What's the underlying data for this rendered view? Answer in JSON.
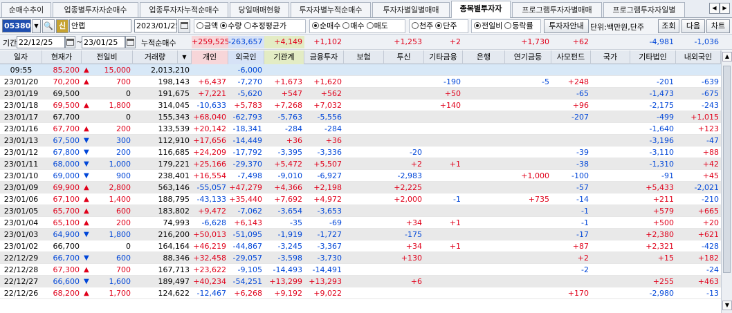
{
  "tabs": [
    "순매수추이",
    "업종별투자자순매수",
    "업종투자자누적순매수",
    "당일매매현황",
    "투자자별누적순매수",
    "투자자별일별매매",
    "종목별투자자",
    "프로그램투자자별매매",
    "프로그램투자자일별"
  ],
  "active_tab": 6,
  "toolbar": {
    "code": "053800",
    "badge": "신",
    "name": "안랩",
    "date": "2023/01/25",
    "r1": [
      "금액",
      "수량",
      "추정평균가"
    ],
    "r1_sel": 1,
    "r2": [
      "순매수",
      "매수",
      "매도"
    ],
    "r2_sel": 0,
    "r3": [
      "천주",
      "단주"
    ],
    "r3_sel": 1,
    "r4": [
      "전일비",
      "등락률"
    ],
    "r4_sel": 0,
    "guide": "투자자안내",
    "unit": "단위:백만원,단주",
    "query": "조회",
    "next": "다음",
    "chart": "차트"
  },
  "filter": {
    "label": "기간",
    "from": "22/12/25",
    "tilde": "~",
    "to": "23/01/25",
    "cum": "누적순매수",
    "sums": [
      "",
      "",
      "",
      "",
      "",
      "+259,525",
      "-263,657",
      "+4,149",
      "+1,102",
      "",
      "+1,253",
      "+2",
      "",
      "+1,730",
      "+62",
      "",
      "-4,981",
      "-1,036"
    ]
  },
  "columns": [
    "일자",
    "현재가",
    "전일비",
    "거래량",
    "개인",
    "외국인",
    "기관계",
    "금융투자",
    "보험",
    "투신",
    "기타금융",
    "은행",
    "연기금등",
    "사모펀드",
    "국가",
    "기타법인",
    "내외국인"
  ],
  "rows": [
    [
      "09:55",
      "85,200",
      "u",
      "15,000",
      "2,013,210",
      "",
      "-6,000",
      "",
      "",
      "",
      "",
      "",
      "",
      "",
      "",
      "",
      ""
    ],
    [
      "23/01/20",
      "70,200",
      "u",
      "700",
      "198,143",
      "+6,437",
      "-7,270",
      "+1,673",
      "+1,620",
      "",
      "",
      "-190",
      "",
      "-5",
      "+248",
      "",
      "-201",
      "-639"
    ],
    [
      "23/01/19",
      "69,500",
      "",
      "0",
      "191,675",
      "+7,221",
      "-5,620",
      "+547",
      "+562",
      "",
      "",
      "+50",
      "",
      "",
      "-65",
      "",
      "-1,473",
      "-675"
    ],
    [
      "23/01/18",
      "69,500",
      "u",
      "1,800",
      "314,045",
      "-10,633",
      "+5,783",
      "+7,268",
      "+7,032",
      "",
      "",
      "+140",
      "",
      "",
      "+96",
      "",
      "-2,175",
      "-243"
    ],
    [
      "23/01/17",
      "67,700",
      "",
      "0",
      "155,343",
      "+68,040",
      "-62,793",
      "-5,763",
      "-5,556",
      "",
      "",
      "",
      "",
      "",
      "-207",
      "",
      "-499",
      "+1,015"
    ],
    [
      "23/01/16",
      "67,700",
      "u",
      "200",
      "133,539",
      "+20,142",
      "-18,341",
      "-284",
      "-284",
      "",
      "",
      "",
      "",
      "",
      "",
      "",
      "-1,640",
      "+123"
    ],
    [
      "23/01/13",
      "67,500",
      "d",
      "300",
      "112,910",
      "+17,656",
      "-14,449",
      "+36",
      "+36",
      "",
      "",
      "",
      "",
      "",
      "",
      "",
      "-3,196",
      "-47"
    ],
    [
      "23/01/12",
      "67,800",
      "d",
      "200",
      "116,685",
      "+24,209",
      "-17,792",
      "-3,395",
      "-3,336",
      "",
      "-20",
      "",
      "",
      "",
      "-39",
      "",
      "-3,110",
      "+88"
    ],
    [
      "23/01/11",
      "68,000",
      "d",
      "1,000",
      "179,221",
      "+25,166",
      "-29,370",
      "+5,472",
      "+5,507",
      "",
      "+2",
      "+1",
      "",
      "",
      "-38",
      "",
      "-1,310",
      "+42"
    ],
    [
      "23/01/10",
      "69,000",
      "d",
      "900",
      "238,401",
      "+16,554",
      "-7,498",
      "-9,010",
      "-6,927",
      "",
      "-2,983",
      "",
      "",
      "+1,000",
      "-100",
      "",
      "-91",
      "+45"
    ],
    [
      "23/01/09",
      "69,900",
      "u",
      "2,800",
      "563,146",
      "-55,057",
      "+47,279",
      "+4,366",
      "+2,198",
      "",
      "+2,225",
      "",
      "",
      "",
      "-57",
      "",
      "+5,433",
      "-2,021"
    ],
    [
      "23/01/06",
      "67,100",
      "u",
      "1,400",
      "188,795",
      "-43,133",
      "+35,440",
      "+7,692",
      "+4,972",
      "",
      "+2,000",
      "-1",
      "",
      "+735",
      "-14",
      "",
      "+211",
      "-210"
    ],
    [
      "23/01/05",
      "65,700",
      "u",
      "600",
      "183,802",
      "+9,472",
      "-7,062",
      "-3,654",
      "-3,653",
      "",
      "",
      "",
      "",
      "",
      "-1",
      "",
      "+579",
      "+665"
    ],
    [
      "23/01/04",
      "65,100",
      "u",
      "200",
      "74,993",
      "-6,628",
      "+6,143",
      "-35",
      "-69",
      "",
      "+34",
      "+1",
      "",
      "",
      "-1",
      "",
      "+500",
      "+20"
    ],
    [
      "23/01/03",
      "64,900",
      "d",
      "1,800",
      "216,200",
      "+50,013",
      "-51,095",
      "-1,919",
      "-1,727",
      "",
      "-175",
      "",
      "",
      "",
      "-17",
      "",
      "+2,380",
      "+621"
    ],
    [
      "23/01/02",
      "66,700",
      "",
      "0",
      "164,164",
      "+46,219",
      "-44,867",
      "-3,245",
      "-3,367",
      "",
      "+34",
      "+1",
      "",
      "",
      "+87",
      "",
      "+2,321",
      "-428"
    ],
    [
      "22/12/29",
      "66,700",
      "d",
      "600",
      "88,346",
      "+32,458",
      "-29,057",
      "-3,598",
      "-3,730",
      "",
      "+130",
      "",
      "",
      "",
      "+2",
      "",
      "+15",
      "+182"
    ],
    [
      "22/12/28",
      "67,300",
      "u",
      "700",
      "167,713",
      "+23,622",
      "-9,105",
      "-14,493",
      "-14,491",
      "",
      "",
      "",
      "",
      "",
      "-2",
      "",
      "",
      "-24"
    ],
    [
      "22/12/27",
      "66,600",
      "d",
      "1,600",
      "189,497",
      "+40,234",
      "-54,251",
      "+13,299",
      "+13,293",
      "",
      "+6",
      "",
      "",
      "",
      "",
      "",
      "+255",
      "+463"
    ],
    [
      "22/12/26",
      "68,200",
      "u",
      "1,700",
      "124,622",
      "-12,467",
      "+6,268",
      "+9,192",
      "+9,022",
      "",
      "",
      "",
      "",
      "",
      "+170",
      "",
      "-2,980",
      "-13"
    ]
  ]
}
